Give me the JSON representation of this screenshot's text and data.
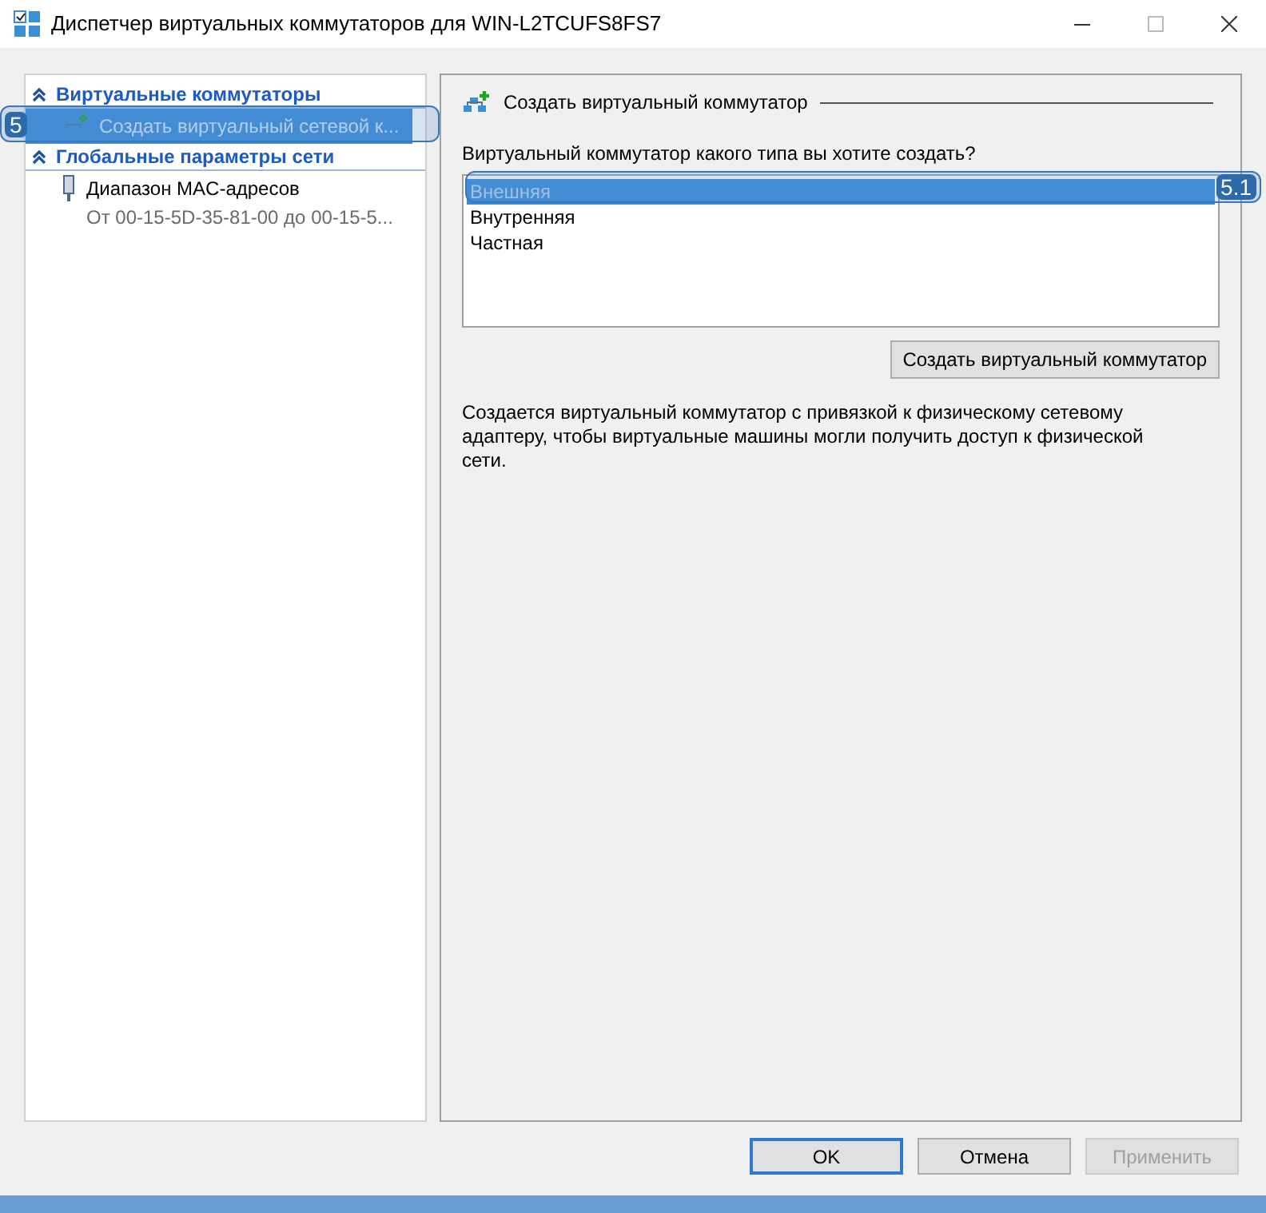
{
  "window": {
    "title": "Диспетчер виртуальных коммутаторов для WIN-L2TCUFS8FS7"
  },
  "sidebar": {
    "sections": [
      {
        "title": "Виртуальные коммутаторы",
        "expanded": true,
        "items": [
          {
            "label": "Создать виртуальный сетевой к...",
            "selected": true,
            "kind": "create",
            "callout": "5"
          }
        ]
      },
      {
        "title": "Глобальные параметры сети",
        "expanded": true,
        "items": [
          {
            "label": "Диапазон MAC-адресов",
            "sublabel": "От 00-15-5D-35-81-00 до 00-15-5...",
            "selected": false,
            "kind": "mac"
          }
        ]
      }
    ]
  },
  "panel": {
    "title": "Создать виртуальный коммутатор",
    "question": "Виртуальный коммутатор какого типа вы хотите создать?",
    "types": [
      {
        "label": "Внешняя",
        "selected": true,
        "callout": "5.1"
      },
      {
        "label": "Внутренняя",
        "selected": false
      },
      {
        "label": "Частная",
        "selected": false
      }
    ],
    "create_button": "Создать виртуальный коммутатор",
    "description": "Создается виртуальный коммутатор с привязкой к физическому сетевому адаптеру, чтобы виртуальные машины могли получить доступ к физической сети."
  },
  "buttons": [
    {
      "label": "OK",
      "default": true,
      "disabled": false
    },
    {
      "label": "Отмена",
      "default": false,
      "disabled": false
    },
    {
      "label": "Применить",
      "default": false,
      "disabled": true
    }
  ]
}
